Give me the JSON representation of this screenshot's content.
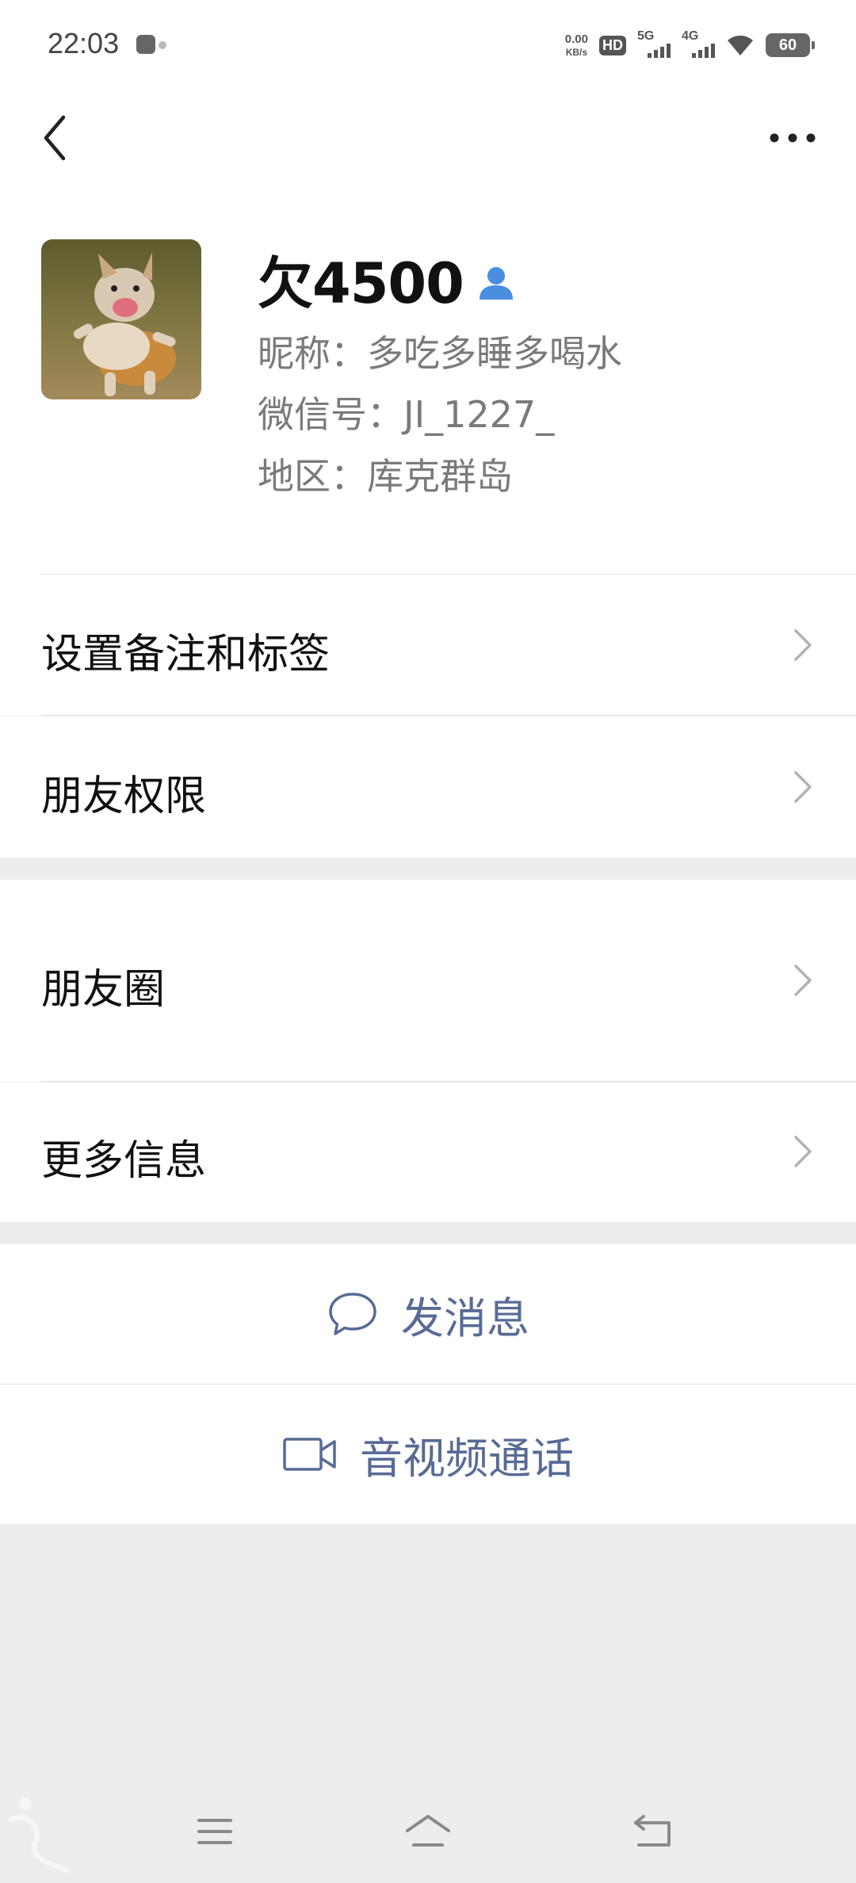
{
  "status_bar": {
    "time": "22:03",
    "net_speed_value": "0.00",
    "net_speed_unit": "KB/s",
    "hd_label": "HD",
    "sim1_label": "5G",
    "sim2_label": "4G",
    "battery": "60"
  },
  "profile": {
    "display_name": "欠4500",
    "nickname_line": "昵称：多吃多睡多喝水",
    "wechat_id_line": "微信号：JI_1227_",
    "region_line": "地区：库克群岛"
  },
  "menu": {
    "remark_tags": "设置备注和标签",
    "friend_permissions": "朋友权限",
    "moments": "朋友圈",
    "more_info": "更多信息"
  },
  "actions": {
    "send_message": "发消息",
    "av_call": "音视频通话"
  },
  "colors": {
    "accent_link": "#576b95",
    "contact_icon": "#4a8ee0",
    "page_bg": "#ededed"
  }
}
